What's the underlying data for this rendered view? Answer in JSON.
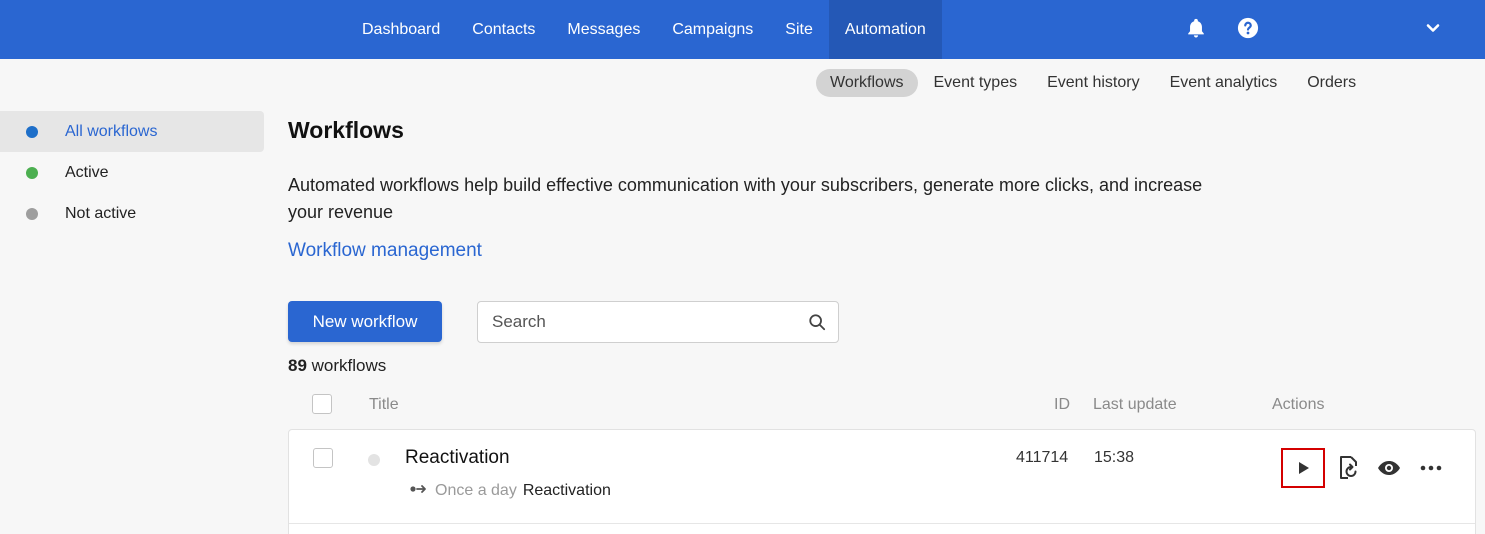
{
  "nav": {
    "items": [
      {
        "label": "Dashboard"
      },
      {
        "label": "Contacts"
      },
      {
        "label": "Messages"
      },
      {
        "label": "Campaigns"
      },
      {
        "label": "Site"
      },
      {
        "label": "Automation"
      }
    ],
    "active": "Automation",
    "icons": [
      "bell-icon",
      "help-icon",
      "chevron-down-icon"
    ]
  },
  "subnav": {
    "items": [
      {
        "label": "Workflows"
      },
      {
        "label": "Event types"
      },
      {
        "label": "Event history"
      },
      {
        "label": "Event analytics"
      },
      {
        "label": "Orders"
      }
    ],
    "active": "Workflows"
  },
  "sidebar": {
    "items": [
      {
        "label": "All workflows",
        "dot_color": "#1e6fc9"
      },
      {
        "label": "Active",
        "dot_color": "#4caf50"
      },
      {
        "label": "Not active",
        "dot_color": "#9e9e9e"
      }
    ]
  },
  "main": {
    "title": "Workflows",
    "description": "Automated workflows help build effective communication with your subscribers, generate more clicks, and increase your revenue",
    "link": "Workflow management",
    "new_button": "New workflow",
    "search_placeholder": "Search",
    "count_number": "89",
    "count_label": "workflows"
  },
  "table": {
    "headers": {
      "title": "Title",
      "id": "ID",
      "last_update": "Last update",
      "actions": "Actions"
    },
    "rows": [
      {
        "title": "Reactivation",
        "trigger": "Once a day",
        "trigger_name": "Reactivation",
        "id": "411714",
        "last_update": "15:38",
        "actions": [
          "play-icon",
          "duplicate-icon",
          "eye-icon",
          "more-icon"
        ]
      }
    ]
  },
  "colors": {
    "brand": "#2a66d1",
    "highlight": "#d40000"
  }
}
